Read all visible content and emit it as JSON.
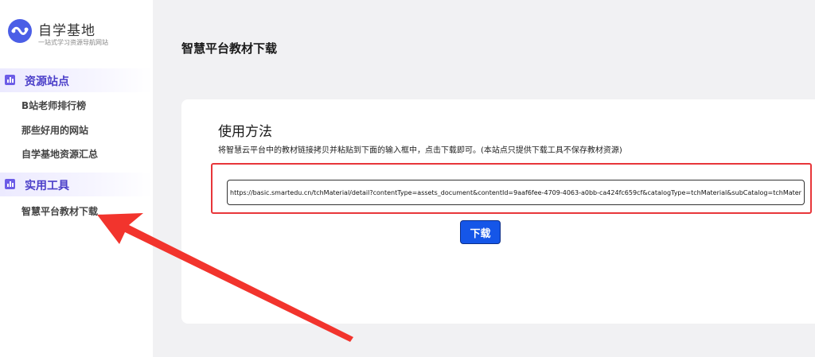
{
  "brand": {
    "title": "自学基地",
    "subtitle": "一站式学习资源导航网站",
    "logo_color": "#4b5ee6"
  },
  "sidebar": {
    "sections": [
      {
        "label": "资源站点",
        "icon": "bar-chart-icon",
        "items": [
          {
            "label": "B站老师排行榜"
          },
          {
            "label": "那些好用的网站"
          },
          {
            "label": "自学基地资源汇总"
          }
        ]
      },
      {
        "label": "实用工具",
        "icon": "bar-chart-icon",
        "items": [
          {
            "label": "智慧平台教材下载"
          }
        ]
      }
    ]
  },
  "main": {
    "page_title": "智慧平台教材下载",
    "usage_title": "使用方法",
    "usage_desc": "将智慧云平台中的教材链接拷贝并粘贴到下面的输入框中，点击下载即可。(本站点只提供下载工具不保存教材资源)",
    "url_value": "https://basic.smartedu.cn/tchMaterial/detail?contentType=assets_document&contentId=9aaf6fee-4709-4063-a0bb-ca424fc659cf&catalogType=tchMaterial&subCatalog=tchMaterial",
    "download_label": "下载"
  },
  "colors": {
    "accent": "#6c5ce7",
    "button": "#1556e8",
    "highlight": "#e8363a"
  }
}
